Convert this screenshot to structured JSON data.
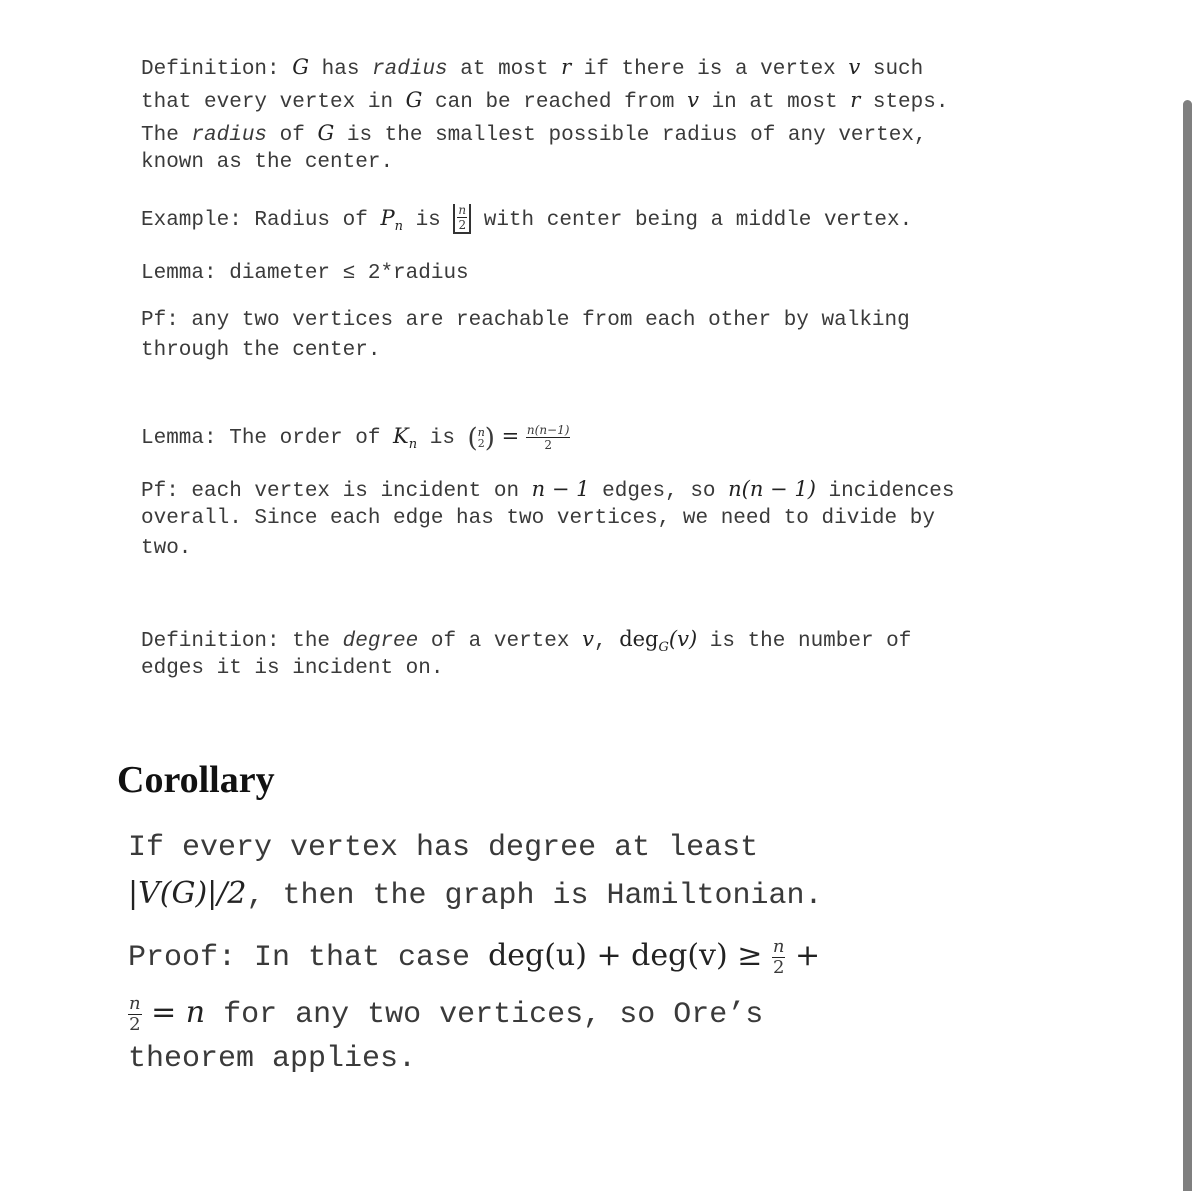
{
  "definition_radius": {
    "line1": [
      "Definition: ",
      "G",
      " has ",
      "radius",
      " at most ",
      "r",
      " if there is a vertex ",
      "v",
      " such"
    ],
    "line2": [
      "that every vertex in ",
      "G",
      " can be reached from ",
      "v",
      " in at most ",
      "r",
      " steps."
    ],
    "line3": [
      "The ",
      "radius",
      " of ",
      "G",
      " is the smallest possible radius of any vertex,"
    ],
    "line4": "known as the center."
  },
  "example": {
    "prefix": "Example: Radius of ",
    "P": "P",
    "sub": "n",
    "is": " is ",
    "floor_num": "n",
    "floor_den": "2",
    "suffix": " with center being a middle vertex."
  },
  "lemma_diameter": "Lemma: diameter ≤ 2*radius",
  "pf_diameter": {
    "line1": "Pf: any two vertices are reachable from each other by walking",
    "line2": "through the center."
  },
  "lemma_order": {
    "prefix": "Lemma: The order of ",
    "K": "K",
    "sub": "n",
    "is": " is ",
    "binom_top": "n",
    "binom_bottom": "2",
    "eq": " = ",
    "frac_num": "n(n−1)",
    "frac_den": "2"
  },
  "pf_order": {
    "line1_a": "Pf: each vertex is incident on ",
    "line1_m1": "n − 1",
    "line1_b": " edges, so ",
    "line1_m2": "n(n − 1)",
    "line1_c": " incidences",
    "line2": "overall. Since each edge has two vertices, we need to divide by",
    "line3": "two."
  },
  "definition_degree": {
    "a": "Definition: the ",
    "em": "degree",
    "b": " of a vertex ",
    "v": "v",
    "c": ", ",
    "deg": "deg",
    "sub": "G",
    "arg": "(v)",
    "d": " is the number of",
    "line2": "edges it is incident on."
  },
  "corollary": {
    "heading": "Corollary",
    "statement_line1": "If every vertex has degree at least",
    "statement_m": "|V(G)|/2",
    "statement_line2": ", then the graph is Hamiltonian.",
    "proof_a": "Proof: In that case ",
    "proof_m1": "deg(u) + deg(v) ≥ ",
    "frac_num": "n",
    "frac_den": "2",
    "plus": " +",
    "proof_m2": " = n",
    "proof_b": " for any two vertices, so Ore’s",
    "proof_c": "theorem applies."
  }
}
